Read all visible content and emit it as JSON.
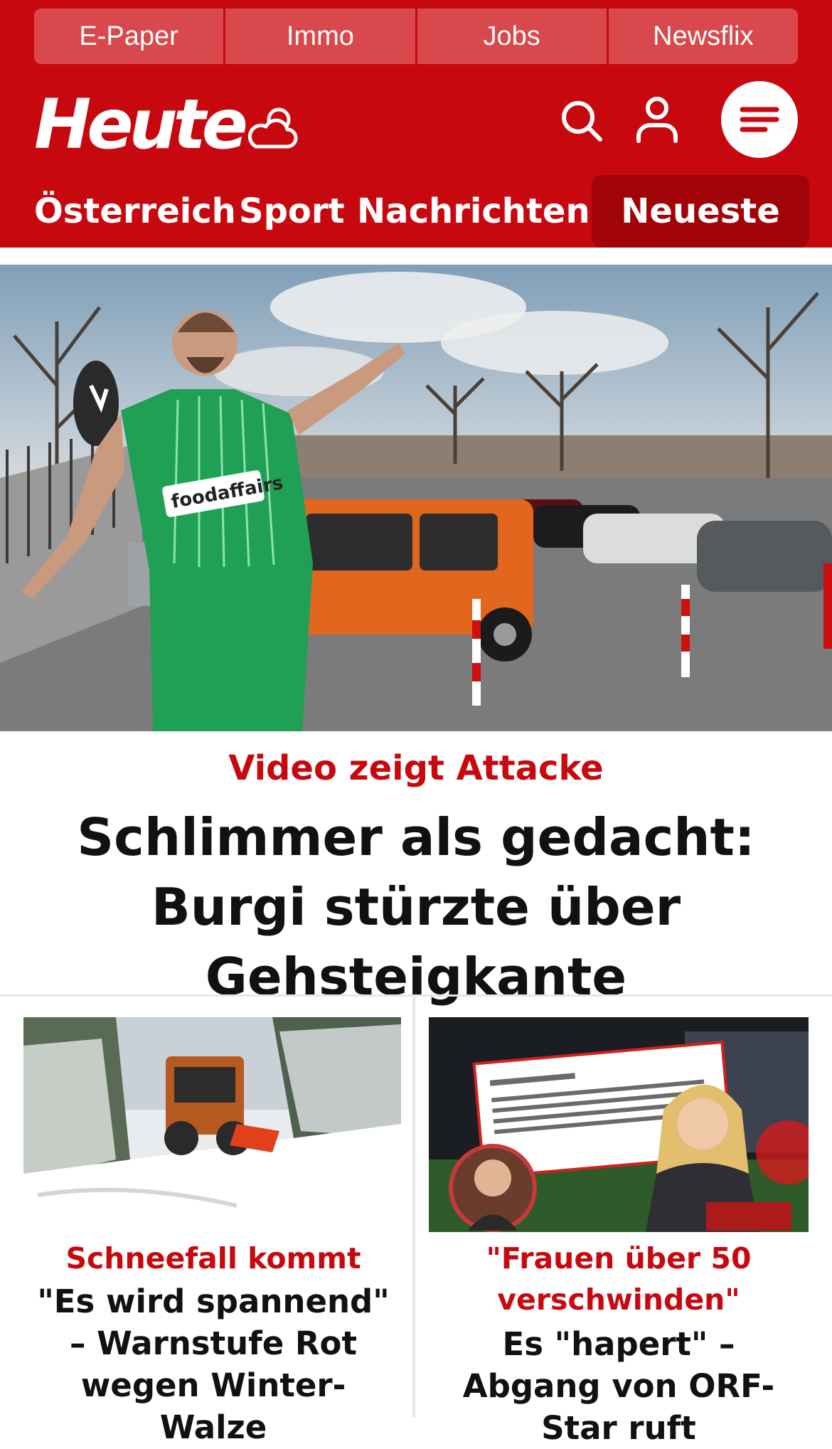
{
  "quick_links": [
    "E-Paper",
    "Immo",
    "Jobs",
    "Newsflix"
  ],
  "brand": {
    "logo_text": "Heute"
  },
  "icons": {
    "weather": "cloud-icon",
    "search": "search-icon",
    "user": "user-icon",
    "menu": "menu-icon"
  },
  "nav": {
    "items": [
      "Österreich",
      "Sport",
      "Nachrichten",
      "Neueste"
    ],
    "active": "Neueste"
  },
  "hero": {
    "kicker": "Video zeigt Attacke",
    "title": "Schlimmer als gedacht: Burgi stürzte über Gehsteigkante"
  },
  "cards": [
    {
      "kicker": "Schneefall kommt",
      "title": "\"Es wird spannend\" – Warnstufe Rot wegen Winter-Walze"
    },
    {
      "kicker": "\"Frauen über 50 verschwinden\"",
      "title": "Es \"hapert\" – Abgang von ORF-Star ruft"
    }
  ],
  "colors": {
    "brand_red": "#c8080f",
    "quicklink_bg": "#d9484c",
    "active_tab": "#a00409"
  }
}
